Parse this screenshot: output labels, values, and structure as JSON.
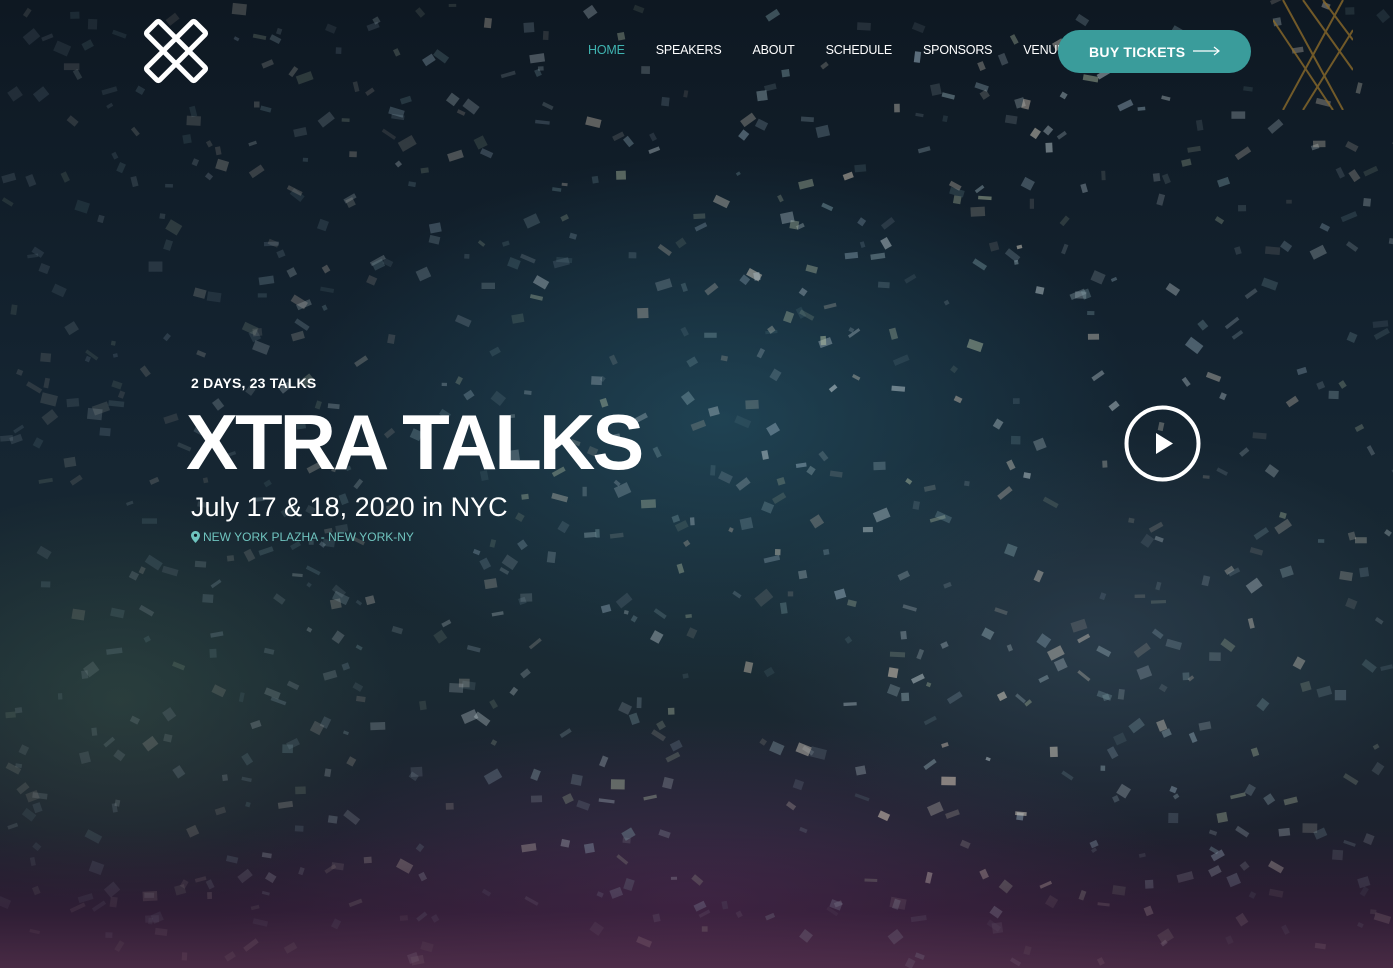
{
  "header": {
    "logo_icon": "x-cross-logo",
    "nav": [
      {
        "label": "HOME",
        "active": true
      },
      {
        "label": "SPEAKERS",
        "active": false
      },
      {
        "label": "ABOUT",
        "active": false
      },
      {
        "label": "SCHEDULE",
        "active": false
      },
      {
        "label": "SPONSORS",
        "active": false
      },
      {
        "label": "VENUE",
        "active": false
      }
    ],
    "buy_button": {
      "label": "BUY TICKETS",
      "icon": "long-arrow-right-icon"
    }
  },
  "hero": {
    "eyebrow": "2 DAYS, 23 TALKS",
    "title": "XTRA TALKS",
    "dates": "July 17 & 18, 2020 in NYC",
    "location_icon": "map-pin-icon",
    "location": "NEW YORK PLAZHA - NEW YORK-NY",
    "play_icon": "play-circle-icon"
  },
  "colors": {
    "accent": "#3a9c9b",
    "accent_text": "#6fc4bf",
    "nav_active": "#3fb3b0"
  }
}
